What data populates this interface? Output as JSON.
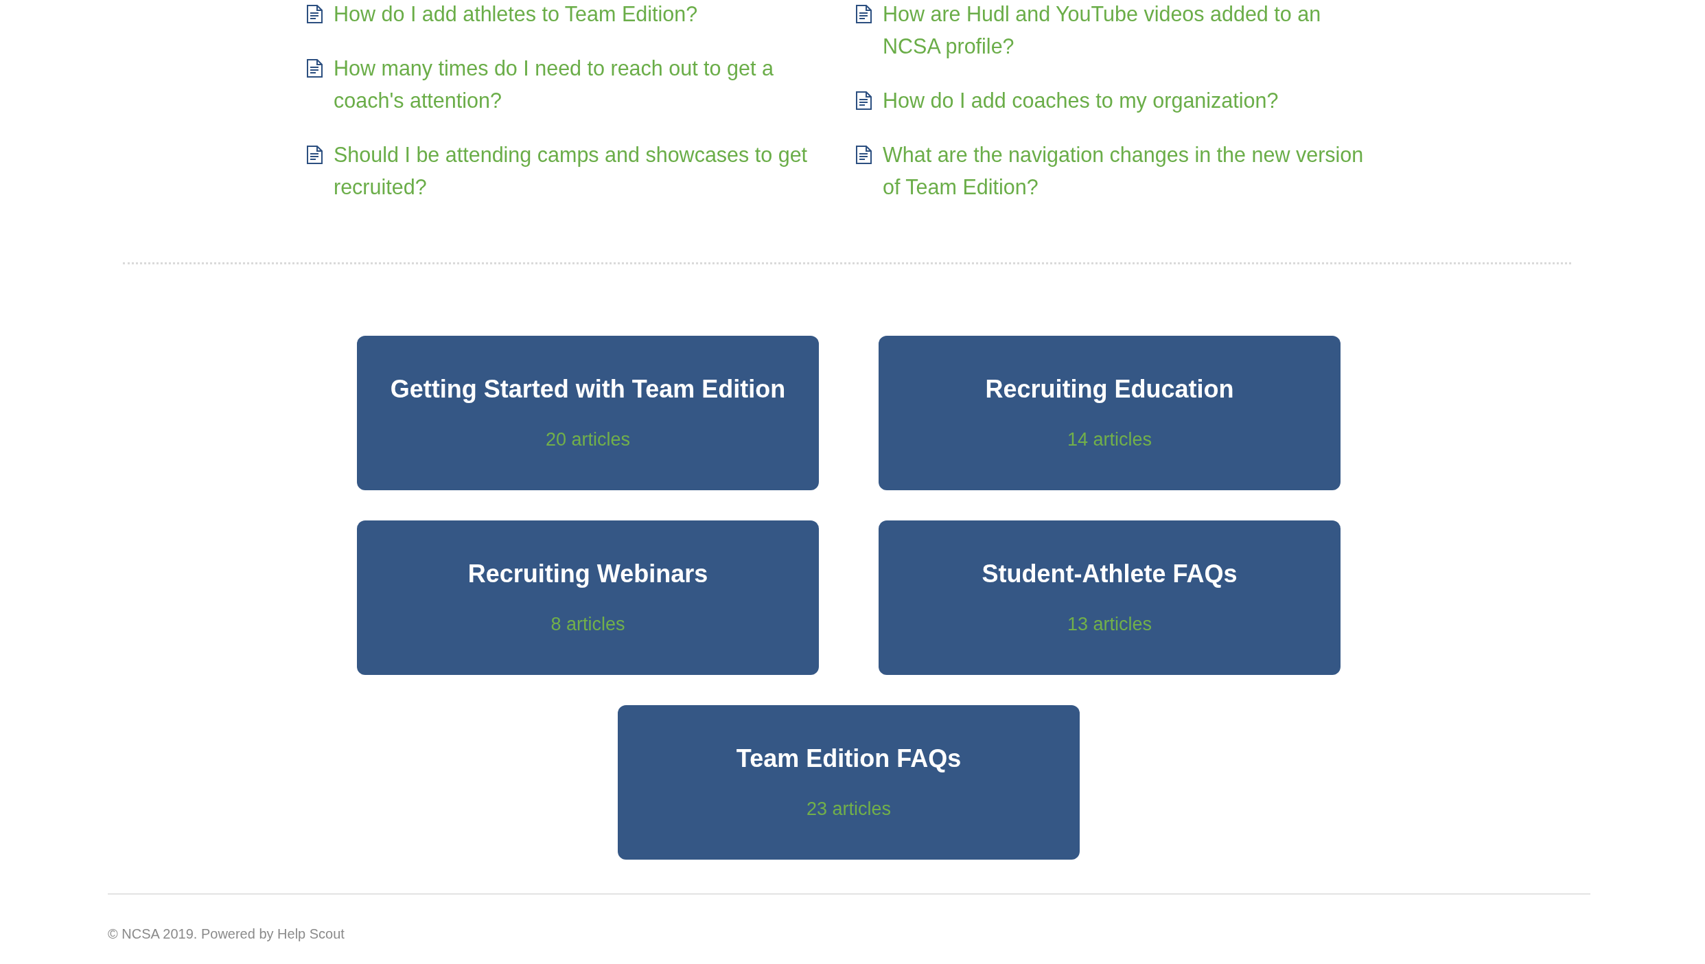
{
  "popular_articles": {
    "columns": [
      {
        "articles": [
          {
            "title": "How do I add athletes to Team Edition?"
          },
          {
            "title": "How many times do I need to reach out to get a coach's attention?"
          },
          {
            "title": "Should I be attending camps and showcases to get recruited?"
          }
        ]
      },
      {
        "articles": [
          {
            "title": "How are Hudl and YouTube videos added to an NCSA profile?"
          },
          {
            "title": "How do I add coaches to my organization?"
          },
          {
            "title": "What are the navigation changes in the new version of Team Edition?"
          }
        ]
      }
    ]
  },
  "categories": [
    {
      "title": "Getting Started with Team Edition",
      "count": "20 articles"
    },
    {
      "title": "Recruiting Education",
      "count": "14 articles"
    },
    {
      "title": "Recruiting Webinars",
      "count": "8 articles"
    },
    {
      "title": "Student-Athlete FAQs",
      "count": "13 articles"
    },
    {
      "title": "Team Edition FAQs",
      "count": "23 articles"
    }
  ],
  "footer": {
    "text": "© NCSA 2019. Powered by Help Scout"
  }
}
